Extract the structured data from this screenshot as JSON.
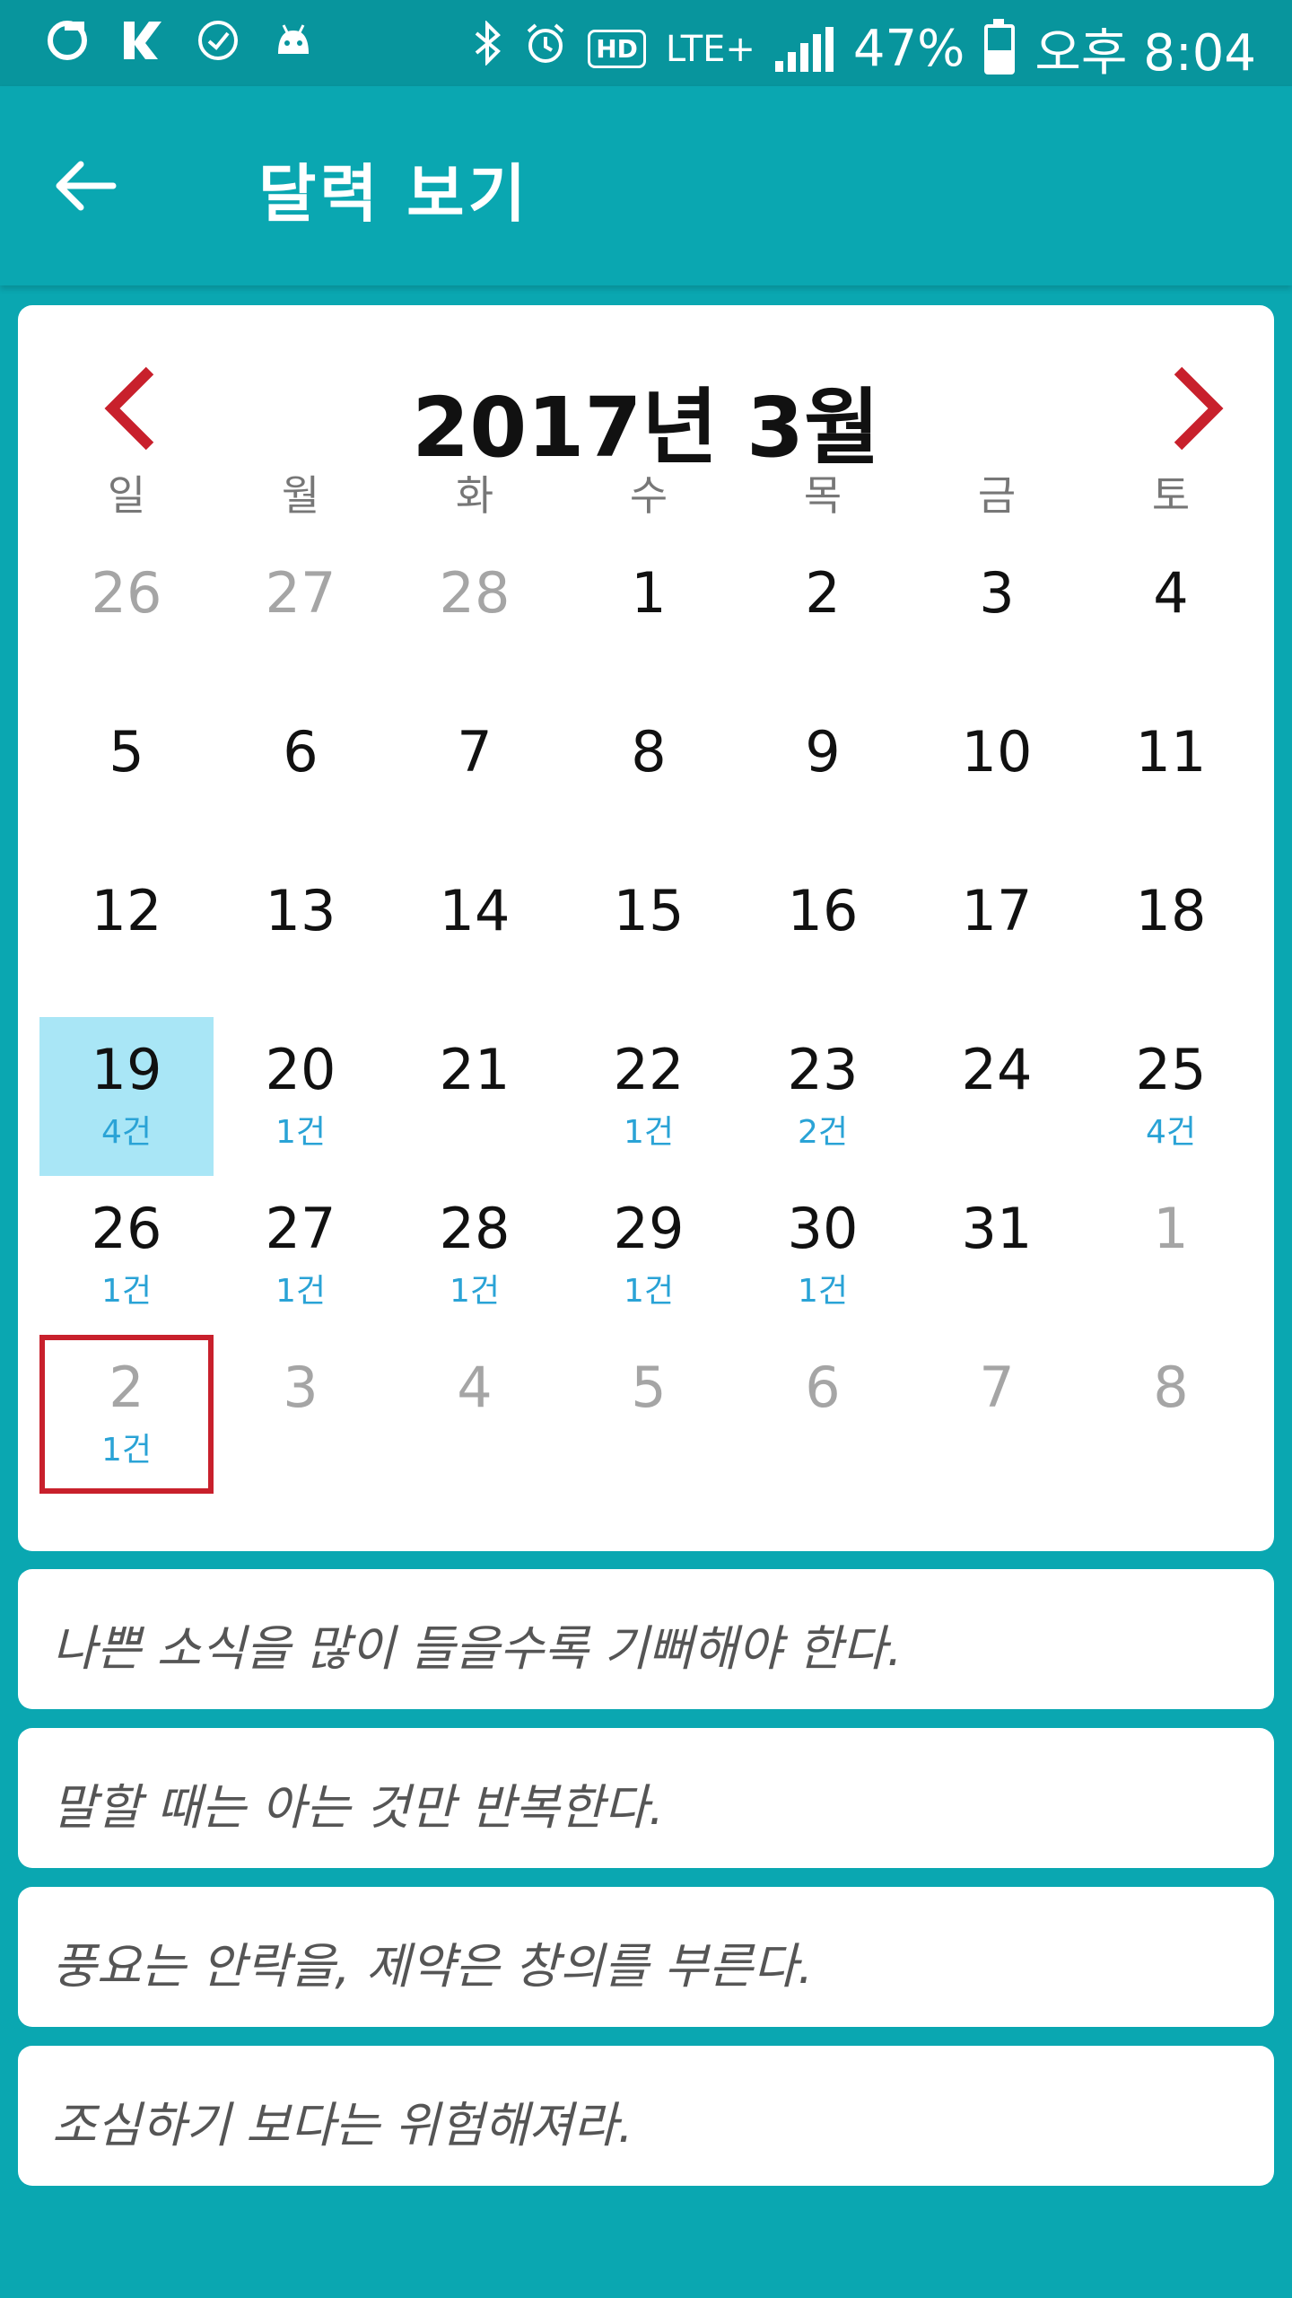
{
  "status_bar": {
    "time": "오후 8:04",
    "battery": "47%",
    "network": "LTE+",
    "hd": "HD",
    "left_icons": [
      "app-icon-g",
      "app-icon-k",
      "clock-check-icon",
      "android-debug-icon"
    ],
    "right_icons": [
      "bluetooth-icon",
      "alarm-icon",
      "hd-voice-icon",
      "lte-plus-icon",
      "signal-icon",
      "battery-charging-icon"
    ]
  },
  "app_bar": {
    "title": "달력 보기",
    "back_icon": "arrow-left-icon"
  },
  "calendar": {
    "title": "2017년 3월",
    "prev_icon": "chevron-left-icon",
    "next_icon": "chevron-right-icon",
    "accent_color": "#c8202c",
    "highlight_color": "#a9e6f6",
    "count_color": "#2aa3d6",
    "weekdays": [
      "일",
      "월",
      "화",
      "수",
      "목",
      "금",
      "토"
    ],
    "weeks": [
      [
        {
          "day": "26",
          "muted": true,
          "count": ""
        },
        {
          "day": "27",
          "muted": true,
          "count": ""
        },
        {
          "day": "28",
          "muted": true,
          "count": ""
        },
        {
          "day": "1",
          "muted": false,
          "count": ""
        },
        {
          "day": "2",
          "muted": false,
          "count": ""
        },
        {
          "day": "3",
          "muted": false,
          "count": ""
        },
        {
          "day": "4",
          "muted": false,
          "count": ""
        }
      ],
      [
        {
          "day": "5",
          "muted": false,
          "count": ""
        },
        {
          "day": "6",
          "muted": false,
          "count": ""
        },
        {
          "day": "7",
          "muted": false,
          "count": ""
        },
        {
          "day": "8",
          "muted": false,
          "count": ""
        },
        {
          "day": "9",
          "muted": false,
          "count": ""
        },
        {
          "day": "10",
          "muted": false,
          "count": ""
        },
        {
          "day": "11",
          "muted": false,
          "count": ""
        }
      ],
      [
        {
          "day": "12",
          "muted": false,
          "count": ""
        },
        {
          "day": "13",
          "muted": false,
          "count": ""
        },
        {
          "day": "14",
          "muted": false,
          "count": ""
        },
        {
          "day": "15",
          "muted": false,
          "count": ""
        },
        {
          "day": "16",
          "muted": false,
          "count": ""
        },
        {
          "day": "17",
          "muted": false,
          "count": ""
        },
        {
          "day": "18",
          "muted": false,
          "count": ""
        }
      ],
      [
        {
          "day": "19",
          "muted": false,
          "count": "4건",
          "highlight": true
        },
        {
          "day": "20",
          "muted": false,
          "count": "1건"
        },
        {
          "day": "21",
          "muted": false,
          "count": ""
        },
        {
          "day": "22",
          "muted": false,
          "count": "1건"
        },
        {
          "day": "23",
          "muted": false,
          "count": "2건"
        },
        {
          "day": "24",
          "muted": false,
          "count": ""
        },
        {
          "day": "25",
          "muted": false,
          "count": "4건"
        }
      ],
      [
        {
          "day": "26",
          "muted": false,
          "count": "1건"
        },
        {
          "day": "27",
          "muted": false,
          "count": "1건"
        },
        {
          "day": "28",
          "muted": false,
          "count": "1건"
        },
        {
          "day": "29",
          "muted": false,
          "count": "1건"
        },
        {
          "day": "30",
          "muted": false,
          "count": "1건"
        },
        {
          "day": "31",
          "muted": false,
          "count": ""
        },
        {
          "day": "1",
          "muted": true,
          "count": ""
        }
      ],
      [
        {
          "day": "2",
          "muted": true,
          "count": "1건",
          "selected": true
        },
        {
          "day": "3",
          "muted": true,
          "count": ""
        },
        {
          "day": "4",
          "muted": true,
          "count": ""
        },
        {
          "day": "5",
          "muted": true,
          "count": ""
        },
        {
          "day": "6",
          "muted": true,
          "count": ""
        },
        {
          "day": "7",
          "muted": true,
          "count": ""
        },
        {
          "day": "8",
          "muted": true,
          "count": ""
        }
      ]
    ]
  },
  "quotes": [
    "나쁜 소식을 많이 들을수록 기뻐해야 한다.",
    "말할 때는 아는 것만 반복한다.",
    "풍요는 안락을, 제약은 창의를 부른다.",
    "조심하기 보다는 위험해져라."
  ]
}
